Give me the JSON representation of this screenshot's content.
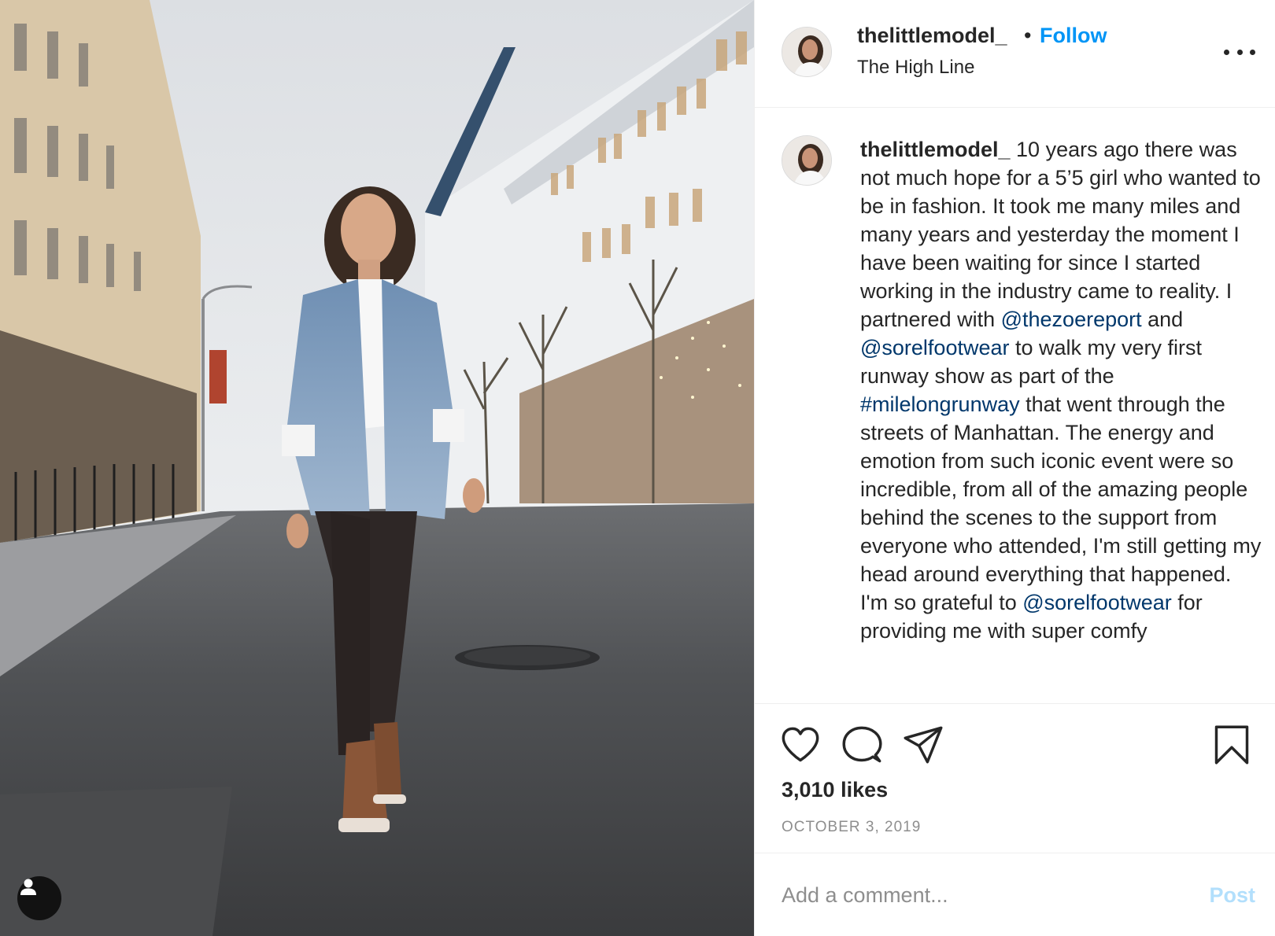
{
  "post": {
    "username": "thelittlemodel_",
    "separator": "•",
    "follow_label": "Follow",
    "location": "The High Line",
    "more_icon": "more-options-icon"
  },
  "caption": {
    "username": "thelittlemodel_",
    "text_1": " 10 years ago there was not much hope for a 5’5 girl who wanted to be in fashion. It took me many miles and many years and yesterday the moment I have been waiting for since I started working in the industry came to reality. I partnered with ",
    "mention_1": "@thezoereport",
    "text_2": " and ",
    "mention_2": "@sorelfootwear",
    "text_3": " to walk my very first runway show as part of the ",
    "hashtag_1": "#milelongrunway",
    "text_4": " that went through the streets of Manhattan. The energy and emotion from such iconic event were so incredible, from all of the amazing people behind the scenes to the support from everyone who attended, I'm still getting my head around everything that happened. I'm so grateful to ",
    "mention_3": "@sorelfootwear",
    "text_5": " for providing me with super comfy"
  },
  "actions": {
    "icons": [
      "heart-icon",
      "comment-icon",
      "share-icon",
      "bookmark-icon"
    ],
    "likes": "3,010 likes",
    "date": "OCTOBER 3, 2019"
  },
  "comment": {
    "placeholder": "Add a comment...",
    "post_label": "Post"
  },
  "colors": {
    "link_blue": "#0095f6",
    "mention_blue": "#00376b",
    "post_disabled": "#b2dffc",
    "text": "#262626",
    "muted": "#8e8e8e"
  }
}
